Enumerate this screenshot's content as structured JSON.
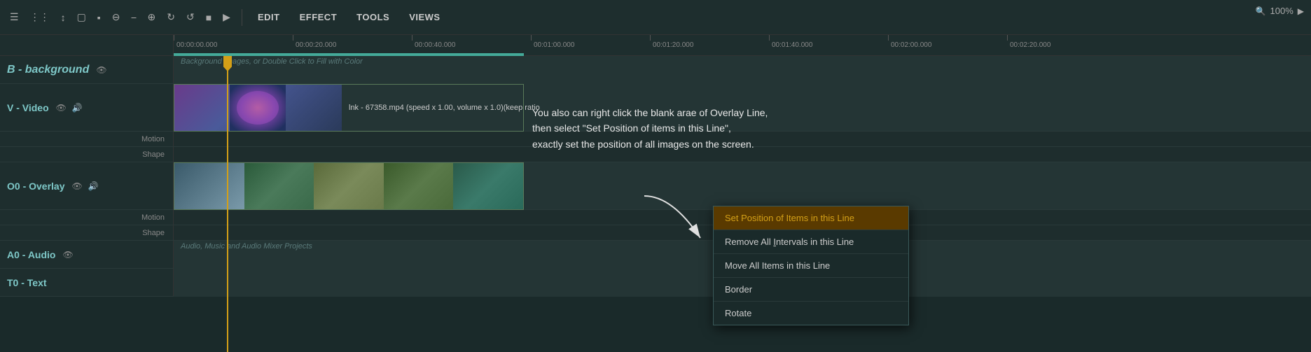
{
  "toolbar": {
    "menu_items": [
      "EDIT",
      "EFFECT",
      "TOOLS",
      "VIEWS"
    ],
    "edit_label": "EDIT",
    "effect_label": "EFFECT",
    "tools_label": "TOOLS",
    "views_label": "VIEWS",
    "zoom_level": "100%"
  },
  "ruler": {
    "ticks": [
      {
        "time": "00:00:00.000",
        "offset": 0
      },
      {
        "time": "00:00:20.000",
        "offset": 170
      },
      {
        "time": "00:00:40.000",
        "offset": 340
      },
      {
        "time": "00:01:00.000",
        "offset": 510
      },
      {
        "time": "00:01:20.000",
        "offset": 680
      },
      {
        "time": "00:01:40.000",
        "offset": 850
      },
      {
        "time": "00:02:00.000",
        "offset": 1020
      },
      {
        "time": "00:02:20.000",
        "offset": 1190
      }
    ]
  },
  "tracks": {
    "background": {
      "name": "B - background",
      "hint": "Background Images, or Double Click to Fill with Color"
    },
    "video": {
      "name": "V - Video",
      "sub1": "Motion",
      "sub2": "Shape",
      "clip_label": "lnk - 67358.mp4  (speed x 1.00, volume x 1.0)(keep ratio"
    },
    "overlay": {
      "name": "O0 - Overlay",
      "sub1": "Motion",
      "sub2": "Shape"
    },
    "audio": {
      "name": "A0 - Audio",
      "hint": "Audio, Music and Audio Mixer Projects"
    },
    "text": {
      "name": "T0 - Text"
    }
  },
  "annotation": {
    "line1": "You also can right click the blank arae of Overlay Line,",
    "line2": "then select \"Set Position of items in this Line\",",
    "line3": "exactly set the position of all images on the screen."
  },
  "context_menu": {
    "items": [
      {
        "label": "Set Position of Items in this Line",
        "highlighted": true,
        "id": "set-position"
      },
      {
        "label": "Remove All Intervals in this Line",
        "highlighted": false,
        "underline": "Intervals",
        "id": "remove-intervals"
      },
      {
        "label": "Move All Items in this Line",
        "highlighted": false,
        "id": "move-all-items"
      },
      {
        "label": "Border",
        "highlighted": false,
        "id": "border"
      },
      {
        "label": "Rotate",
        "highlighted": false,
        "id": "rotate"
      }
    ]
  }
}
